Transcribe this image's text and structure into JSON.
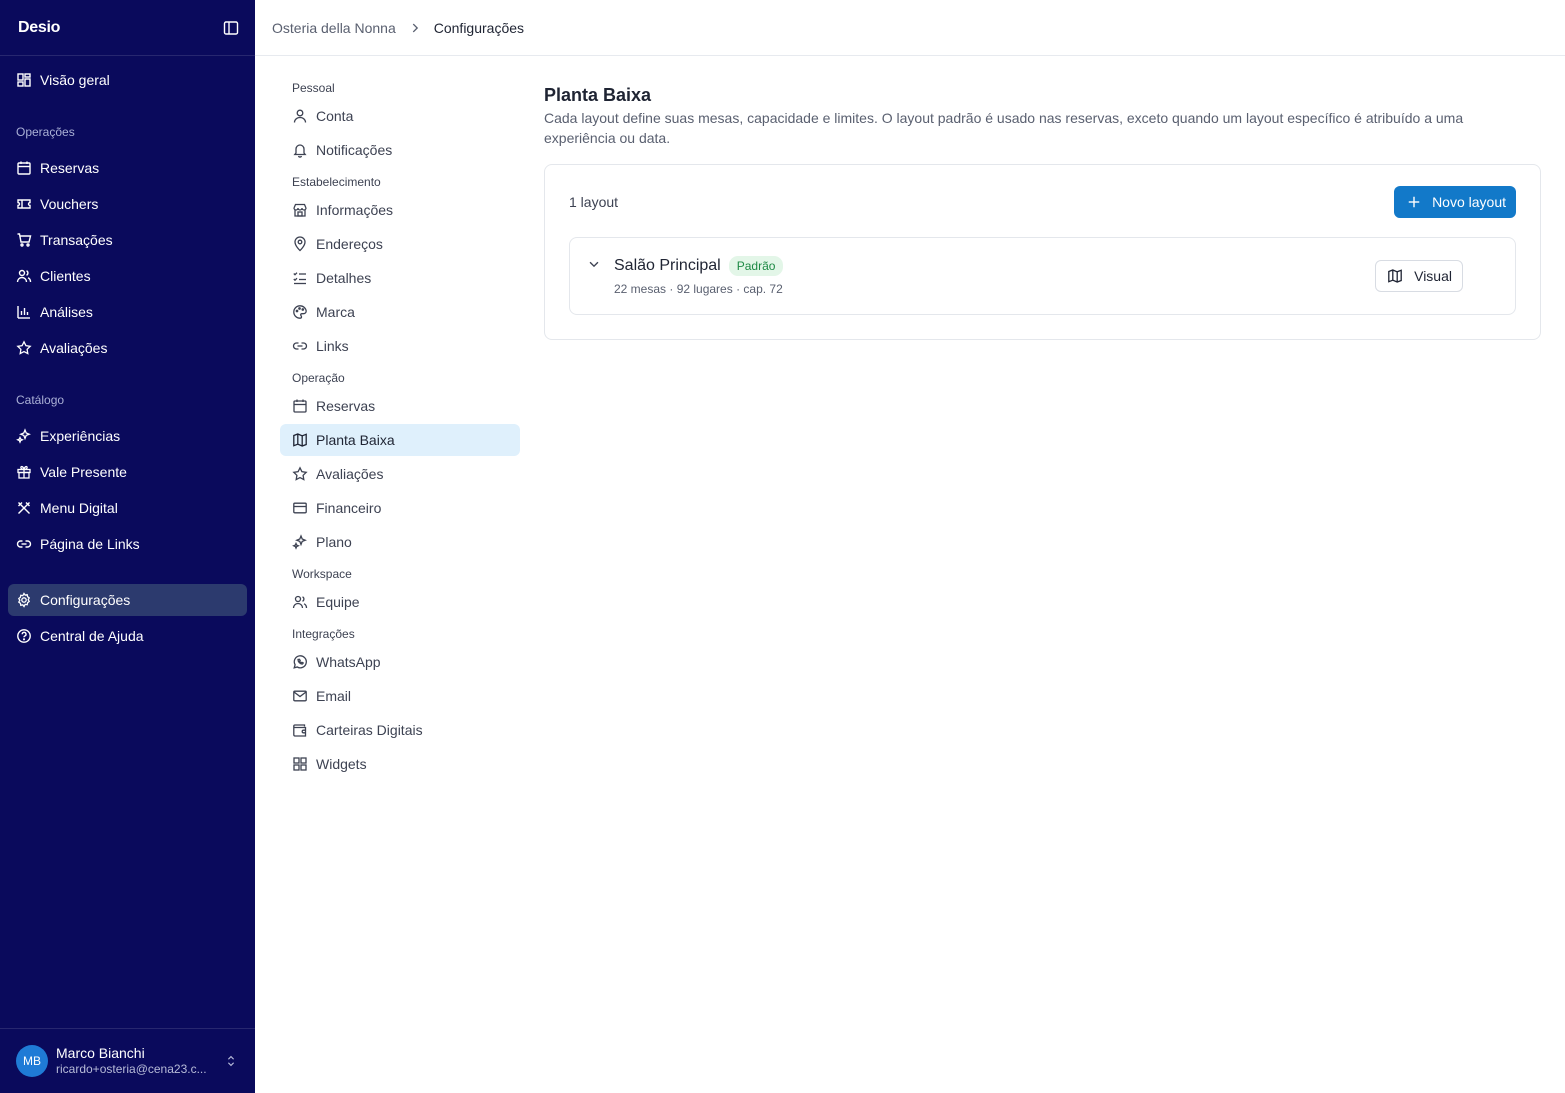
{
  "app": {
    "brand": "Desio",
    "nav_top": [
      {
        "label": "Visão geral",
        "icon": "dashboard-icon"
      }
    ],
    "sections": [
      {
        "title": "Operações",
        "items": [
          {
            "label": "Reservas",
            "icon": "calendar-icon"
          },
          {
            "label": "Vouchers",
            "icon": "ticket-icon"
          },
          {
            "label": "Transações",
            "icon": "cart-icon"
          },
          {
            "label": "Clientes",
            "icon": "users-icon"
          },
          {
            "label": "Análises",
            "icon": "bar-chart-icon"
          },
          {
            "label": "Avaliações",
            "icon": "star-icon"
          }
        ]
      },
      {
        "title": "Catálogo",
        "items": [
          {
            "label": "Experiências",
            "icon": "sparkles-icon"
          },
          {
            "label": "Vale Presente",
            "icon": "gift-icon"
          },
          {
            "label": "Menu Digital",
            "icon": "utensils-icon"
          },
          {
            "label": "Página de Links",
            "icon": "link-icon"
          }
        ]
      }
    ],
    "nav_bottom": [
      {
        "label": "Configurações",
        "icon": "gear-icon",
        "active": true
      },
      {
        "label": "Central de Ajuda",
        "icon": "help-circle-icon"
      }
    ],
    "user": {
      "initials": "MB",
      "name": "Marco Bianchi",
      "email": "ricardo+osteria@cena23.c..."
    }
  },
  "breadcrumb": {
    "parent": "Osteria della Nonna",
    "current": "Configurações"
  },
  "settings_nav": [
    {
      "title": "Pessoal",
      "items": [
        {
          "label": "Conta",
          "icon": "user-icon"
        },
        {
          "label": "Notificações",
          "icon": "bell-icon"
        }
      ]
    },
    {
      "title": "Estabelecimento",
      "items": [
        {
          "label": "Informações",
          "icon": "store-icon"
        },
        {
          "label": "Endereços",
          "icon": "map-pin-icon"
        },
        {
          "label": "Detalhes",
          "icon": "list-checks-icon"
        },
        {
          "label": "Marca",
          "icon": "palette-icon"
        },
        {
          "label": "Links",
          "icon": "link-icon"
        }
      ]
    },
    {
      "title": "Operação",
      "items": [
        {
          "label": "Reservas",
          "icon": "calendar-icon"
        },
        {
          "label": "Planta Baixa",
          "icon": "map-icon",
          "active": true
        },
        {
          "label": "Avaliações",
          "icon": "star-icon"
        },
        {
          "label": "Financeiro",
          "icon": "credit-card-icon"
        },
        {
          "label": "Plano",
          "icon": "sparkles-icon"
        }
      ]
    },
    {
      "title": "Workspace",
      "items": [
        {
          "label": "Equipe",
          "icon": "users-icon"
        }
      ]
    },
    {
      "title": "Integrações",
      "items": [
        {
          "label": "WhatsApp",
          "icon": "whatsapp-icon"
        },
        {
          "label": "Email",
          "icon": "mail-icon"
        },
        {
          "label": "Carteiras Digitais",
          "icon": "wallet-icon"
        },
        {
          "label": "Widgets",
          "icon": "grid-icon"
        }
      ]
    }
  ],
  "main": {
    "title": "Planta Baixa",
    "description": "Cada layout define suas mesas, capacidade e limites. O layout padrão é usado nas reservas, exceto quando um layout específico é atribuído a uma experiência ou data.",
    "count_label": "1 layout",
    "new_button": "Novo layout",
    "layouts": [
      {
        "name": "Salão Principal",
        "badge": "Padrão",
        "meta": "22 mesas · 92 lugares · cap. 72",
        "visual_button": "Visual"
      }
    ]
  },
  "colors": {
    "sidebar_bg": "#0a0a5c",
    "sidebar_active": "#2c3a6e",
    "primary": "#1279c9",
    "settings_active": "#dff0fc",
    "badge_bg": "#e3f6e8",
    "badge_text": "#1e8a45"
  }
}
